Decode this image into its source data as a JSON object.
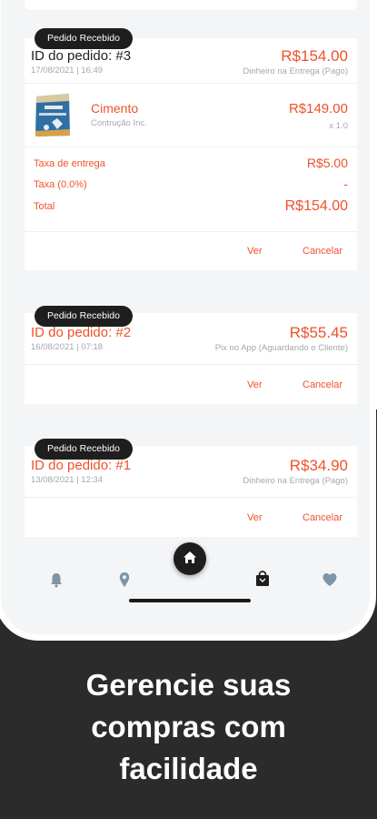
{
  "orders": [
    {
      "status": "Pedido Recebido",
      "id_label": "ID do pedido: #3",
      "date": "17/08/2021 | 16:49",
      "total": "R$154.00",
      "payment": "Dinheiro na Entrega (Pago)",
      "product": {
        "name": "Cimento",
        "brand": "Contrução Inc.",
        "price": "R$149.00",
        "qty": "x 1.0"
      },
      "summary": {
        "delivery_label": "Taxa de entrega",
        "delivery_value": "R$5.00",
        "tax_label": "Taxa (0.0%)",
        "tax_value": "-",
        "total_label": "Total",
        "total_value": "R$154.00"
      },
      "view": "Ver",
      "cancel": "Cancelar"
    },
    {
      "status": "Pedido Recebido",
      "id_label": "ID do pedido: #2",
      "date": "16/08/2021 | 07:18",
      "total": "R$55.45",
      "payment": "Pix no App (Aguardando o Cliente)",
      "view": "Ver",
      "cancel": "Cancelar"
    },
    {
      "status": "Pedido Recebido",
      "id_label": "ID do pedido: #1",
      "date": "13/08/2021 | 12:34",
      "total": "R$34.90",
      "payment": "Dinheiro na Entrega (Pago)",
      "view": "Ver",
      "cancel": "Cancelar"
    }
  ],
  "nav": {
    "icons": [
      "bell-icon",
      "location-pin-icon",
      "home-icon",
      "shopping-bag-icon",
      "heart-icon"
    ],
    "active": "home"
  },
  "headline": {
    "line1": "Gerencie suas",
    "line2": "compras com",
    "line3": "facilidade"
  },
  "colors": {
    "accent": "#f0512a",
    "dark": "#1e1e1e",
    "muted": "#a3a8ad",
    "nav_icon": "#7d95a6",
    "background_dark": "#2b2b2b"
  }
}
